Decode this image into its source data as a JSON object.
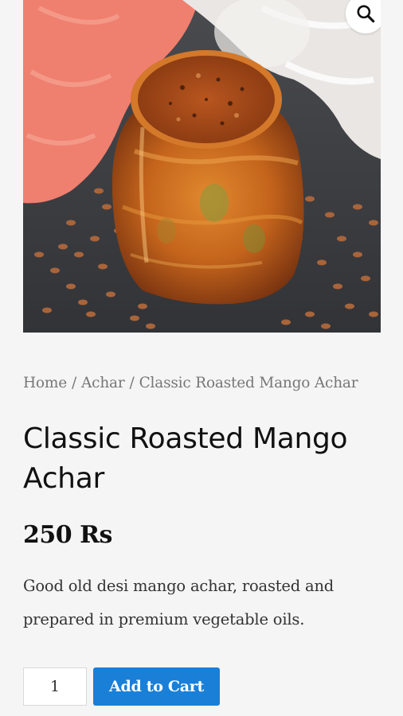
{
  "product": {
    "image_alt": "Jar of classic roasted mango achar",
    "zoom_icon": "search-icon",
    "breadcrumb": [
      {
        "label": "Home"
      },
      {
        "label": "Achar"
      },
      {
        "label": "Classic Roasted Mango Achar"
      }
    ],
    "breadcrumb_separator": "/",
    "title": "Classic Roasted Mango Achar",
    "price": "250 Rs",
    "description": "Good old desi mango achar, roasted and prepared in premium vegetable oils.",
    "quantity": "1",
    "add_to_cart_label": "Add to Cart"
  },
  "colors": {
    "background": "#f5f5f5",
    "button": "#1a7fd6",
    "breadcrumb": "#777777"
  }
}
